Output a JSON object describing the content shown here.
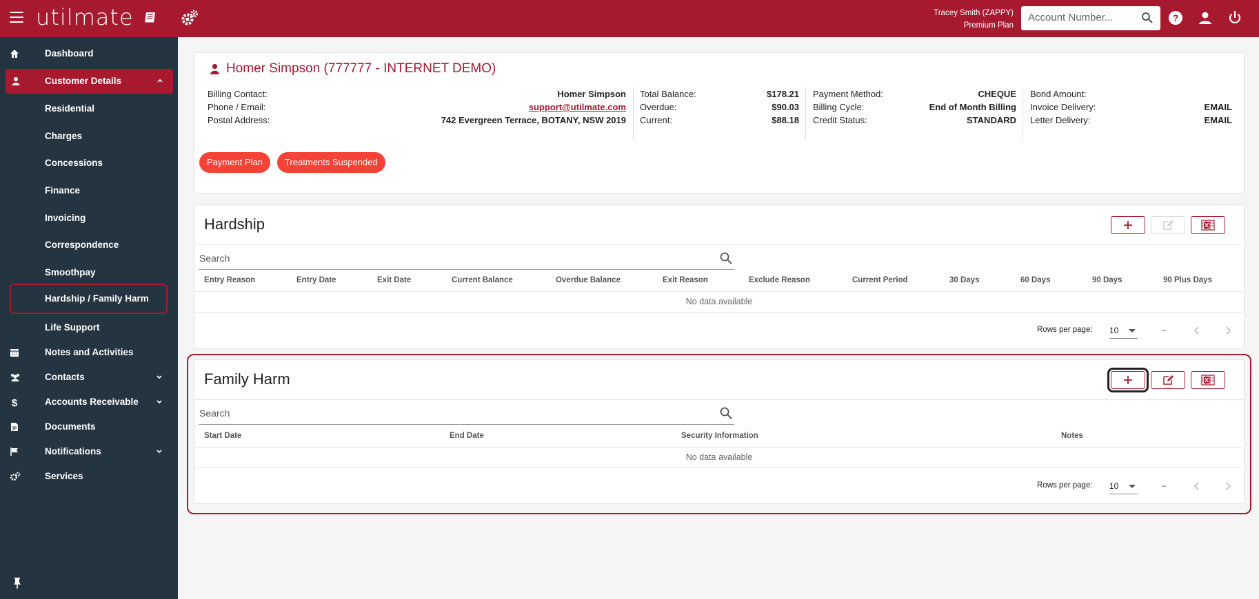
{
  "app": {
    "logo": "utilmate",
    "user_name": "Tracey Smith (ZAPPY)",
    "user_plan": "Premium Plan",
    "search_placeholder": "Account Number..."
  },
  "sidebar": {
    "items": [
      {
        "label": "Dashboard",
        "icon": "home-icon"
      },
      {
        "label": "Customer Details",
        "icon": "user-icon"
      },
      {
        "label": "Notes and Activities",
        "icon": "calendar-icon"
      },
      {
        "label": "Contacts",
        "icon": "people-icon"
      },
      {
        "label": "Accounts Receivable",
        "icon": "dollar-icon"
      },
      {
        "label": "Documents",
        "icon": "document-icon"
      },
      {
        "label": "Notifications",
        "icon": "flag-icon"
      },
      {
        "label": "Services",
        "icon": "gears-icon"
      }
    ],
    "sub_items": [
      "Residential",
      "Charges",
      "Concessions",
      "Finance",
      "Invoicing",
      "Correspondence",
      "Smoothpay",
      "Hardship / Family Harm",
      "Life Support"
    ]
  },
  "customer": {
    "title": "Homer Simpson (777777 - INTERNET DEMO)",
    "col1": [
      {
        "k": "Billing Contact:",
        "v": "Homer Simpson"
      },
      {
        "k": "Phone / Email:",
        "v": "support@utilmate.com"
      },
      {
        "k": "Postal Address:",
        "v": "742 Evergreen Terrace, BOTANY, NSW 2019"
      }
    ],
    "col2": [
      {
        "k": "Total Balance:",
        "v": "$178.21"
      },
      {
        "k": "Overdue:",
        "v": "$90.03"
      },
      {
        "k": "Current:",
        "v": "$88.18"
      }
    ],
    "col3": [
      {
        "k": "Payment Method:",
        "v": "CHEQUE"
      },
      {
        "k": "Billing Cycle:",
        "v": "End of Month Billing"
      },
      {
        "k": "Credit Status:",
        "v": "STANDARD"
      }
    ],
    "col4": [
      {
        "k": "Bond Amount:",
        "v": ""
      },
      {
        "k": "Invoice Delivery:",
        "v": "EMAIL"
      },
      {
        "k": "Letter Delivery:",
        "v": "EMAIL"
      }
    ],
    "chips": [
      "Payment Plan",
      "Treatments Suspended"
    ]
  },
  "hardship": {
    "title": "Hardship",
    "search_placeholder": "Search",
    "columns": [
      "Entry Reason",
      "Entry Date",
      "Exit Date",
      "Current Balance",
      "Overdue Balance",
      "Exit Reason",
      "Exclude Reason",
      "Current Period",
      "30 Days",
      "60 Days",
      "90 Days",
      "90 Plus Days"
    ],
    "empty": "No data available",
    "rows_label": "Rows per page:",
    "rows_value": "10",
    "range": "–"
  },
  "family_harm": {
    "title": "Family Harm",
    "search_placeholder": "Search",
    "columns": [
      "Start Date",
      "End Date",
      "Security Information",
      "Notes"
    ],
    "empty": "No data available",
    "rows_label": "Rows per page:",
    "rows_value": "10",
    "range": "–"
  },
  "colors": {
    "brand": "#a7192e",
    "sidebar": "#253441",
    "chip": "#f44336"
  }
}
